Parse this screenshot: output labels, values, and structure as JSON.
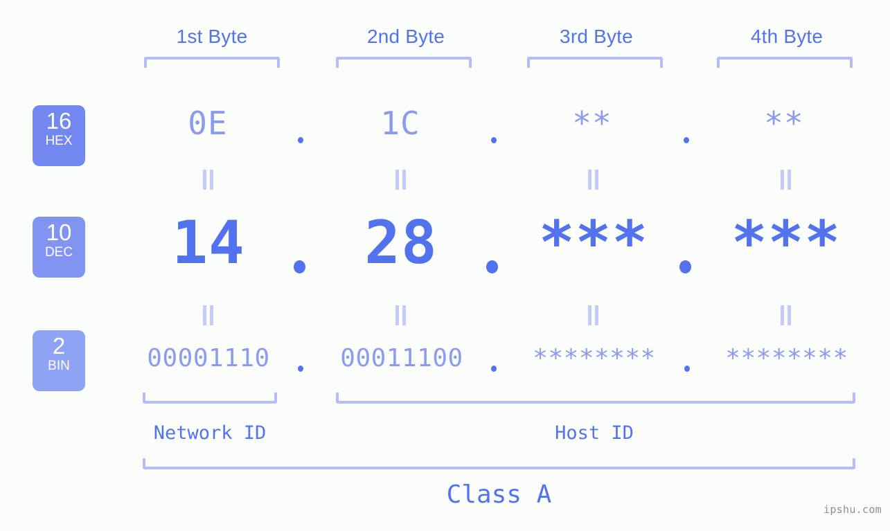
{
  "page": {
    "background": "#fbfdfa",
    "accent": "#5272ee",
    "accent_light": "#8b9bf0",
    "bracket_color": "#b3bdfb",
    "watermark": "ipshu.com"
  },
  "byte_headers": [
    {
      "label": "1st Byte"
    },
    {
      "label": "2nd Byte"
    },
    {
      "label": "3rd Byte"
    },
    {
      "label": "4th Byte"
    }
  ],
  "rows": [
    {
      "key": "hex",
      "badge_number": "16",
      "badge_abbr": "HEX",
      "badge_color": "#7387f0",
      "values": [
        "0E",
        "1C",
        "**",
        "**"
      ],
      "separator": "."
    },
    {
      "key": "dec",
      "badge_number": "10",
      "badge_abbr": "DEC",
      "badge_color": "#8194f2",
      "values": [
        "14",
        "28",
        "***",
        "***"
      ],
      "separator": "."
    },
    {
      "key": "bin",
      "badge_number": "2",
      "badge_abbr": "BIN",
      "badge_color": "#8fa3f5",
      "values": [
        "00001110",
        "00011100",
        "********",
        "********"
      ],
      "separator": "."
    }
  ],
  "equals_symbol": "=",
  "id_sections": [
    {
      "label": "Network ID"
    },
    {
      "label": "Host ID"
    }
  ],
  "class_section": {
    "label": "Class A"
  }
}
